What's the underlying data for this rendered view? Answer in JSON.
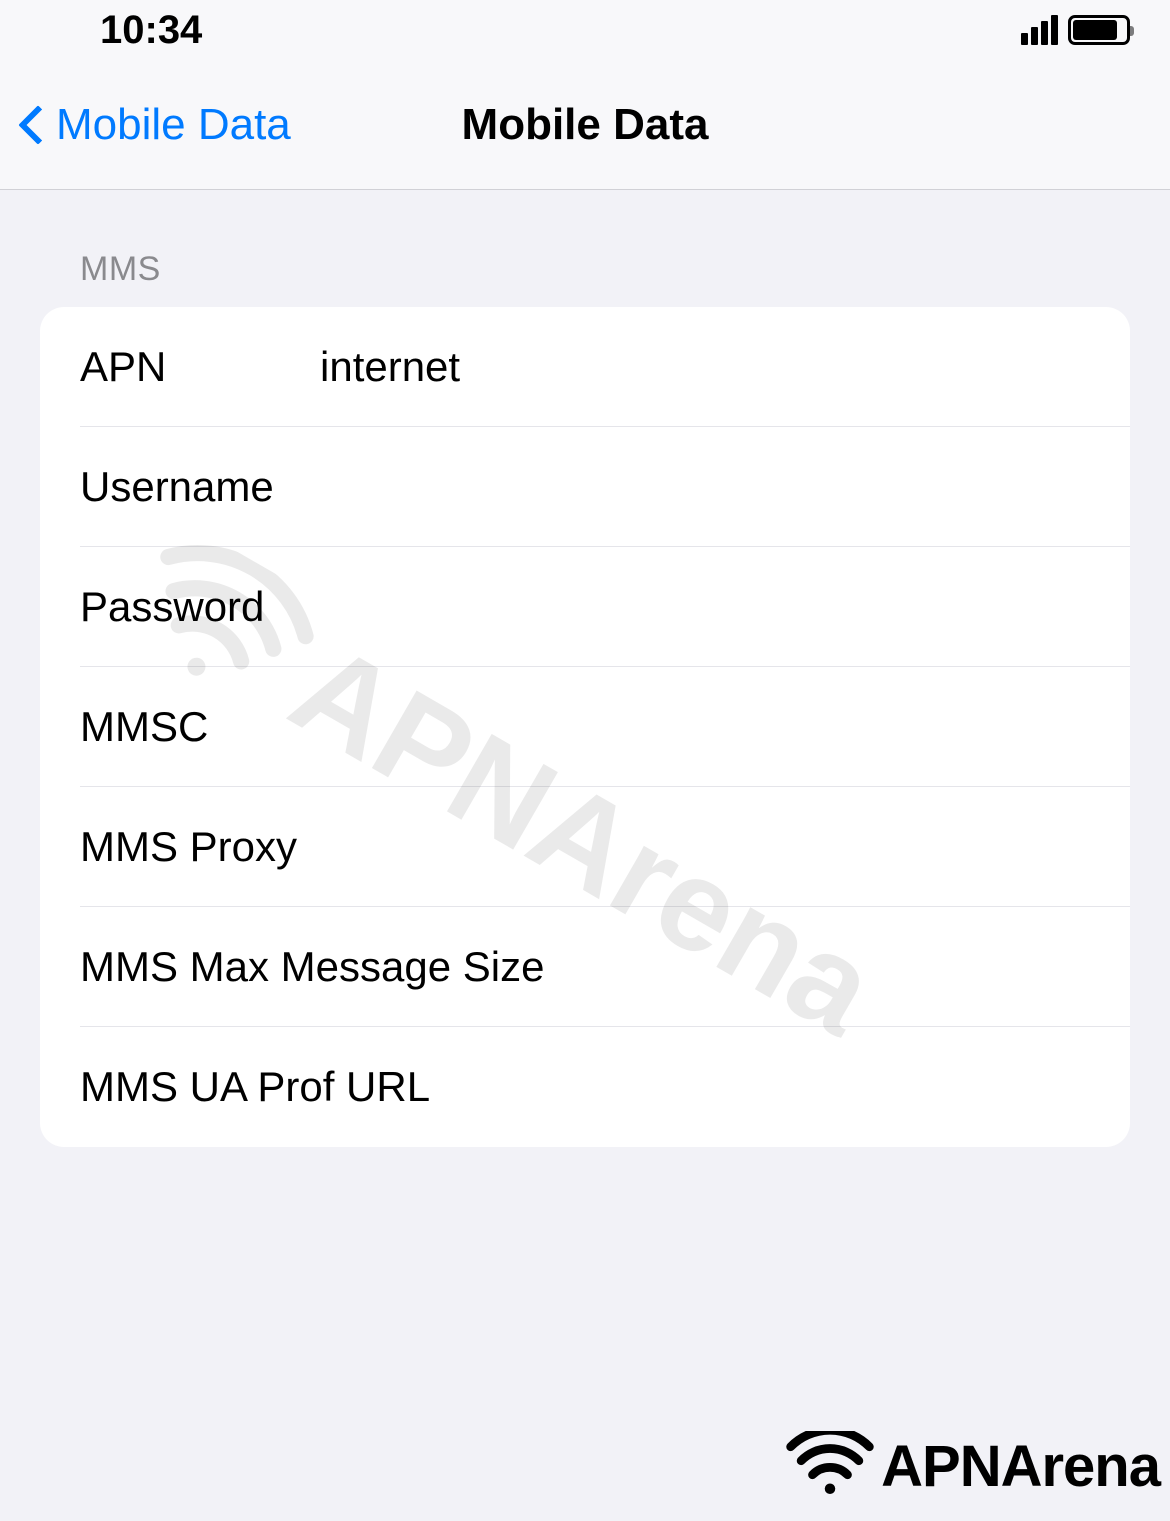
{
  "status": {
    "time": "10:34"
  },
  "nav": {
    "back_label": "Mobile Data",
    "title": "Mobile Data"
  },
  "section": {
    "header": "MMS"
  },
  "fields": {
    "apn": {
      "label": "APN",
      "value": "internet"
    },
    "username": {
      "label": "Username",
      "value": ""
    },
    "password": {
      "label": "Password",
      "value": ""
    },
    "mmsc": {
      "label": "MMSC",
      "value": ""
    },
    "mms_proxy": {
      "label": "MMS Proxy",
      "value": ""
    },
    "mms_max": {
      "label": "MMS Max Message Size",
      "value": ""
    },
    "mms_ua": {
      "label": "MMS UA Prof URL",
      "value": ""
    }
  },
  "watermark": {
    "text": "APNArena"
  },
  "footer": {
    "text": "APNArena"
  }
}
